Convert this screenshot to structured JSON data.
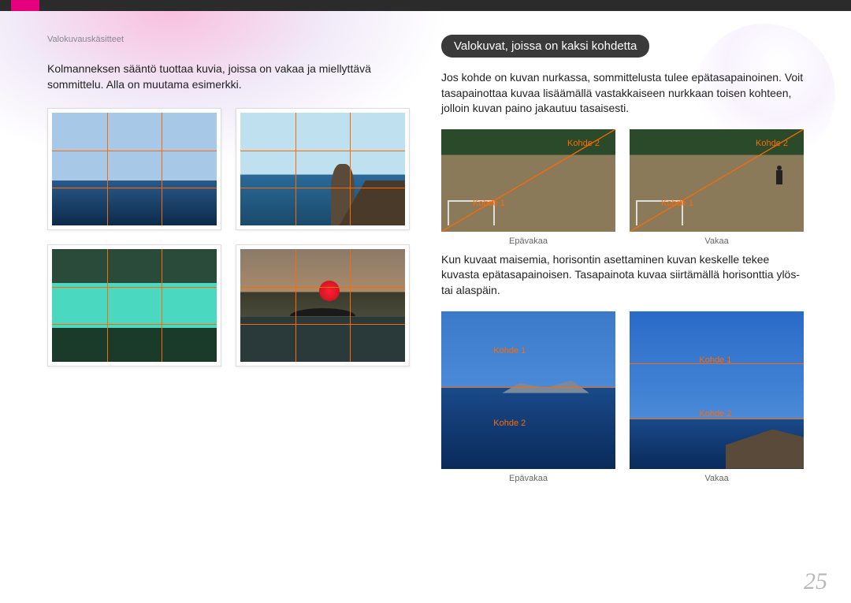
{
  "breadcrumb": "Valokuvauskäsitteet",
  "left": {
    "intro": "Kolmanneksen sääntö tuottaa kuvia, joissa on vakaa ja miellyttävä sommittelu. Alla on muutama esimerkki."
  },
  "right": {
    "heading": "Valokuvat, joissa on kaksi kohdetta",
    "p1": "Jos kohde on kuvan nurkassa, sommittelusta tulee epätasapainoinen. Voit tasapainottaa kuvaa lisäämällä vastakkaiseen nurkkaan toisen kohteen, jolloin kuvan paino jakautuu tasaisesti.",
    "p2": "Kun kuvaat maisemia, horisontin asettaminen kuvan keskelle tekee kuvasta epätasapainoisen. Tasapainota kuvaa siirtämällä horisonttia ylös- tai alaspäin.",
    "labels": {
      "subject1": "Kohde 1",
      "subject2": "Kohde 2",
      "unstable": "Epävakaa",
      "stable": "Vakaa"
    }
  },
  "page_number": "25"
}
